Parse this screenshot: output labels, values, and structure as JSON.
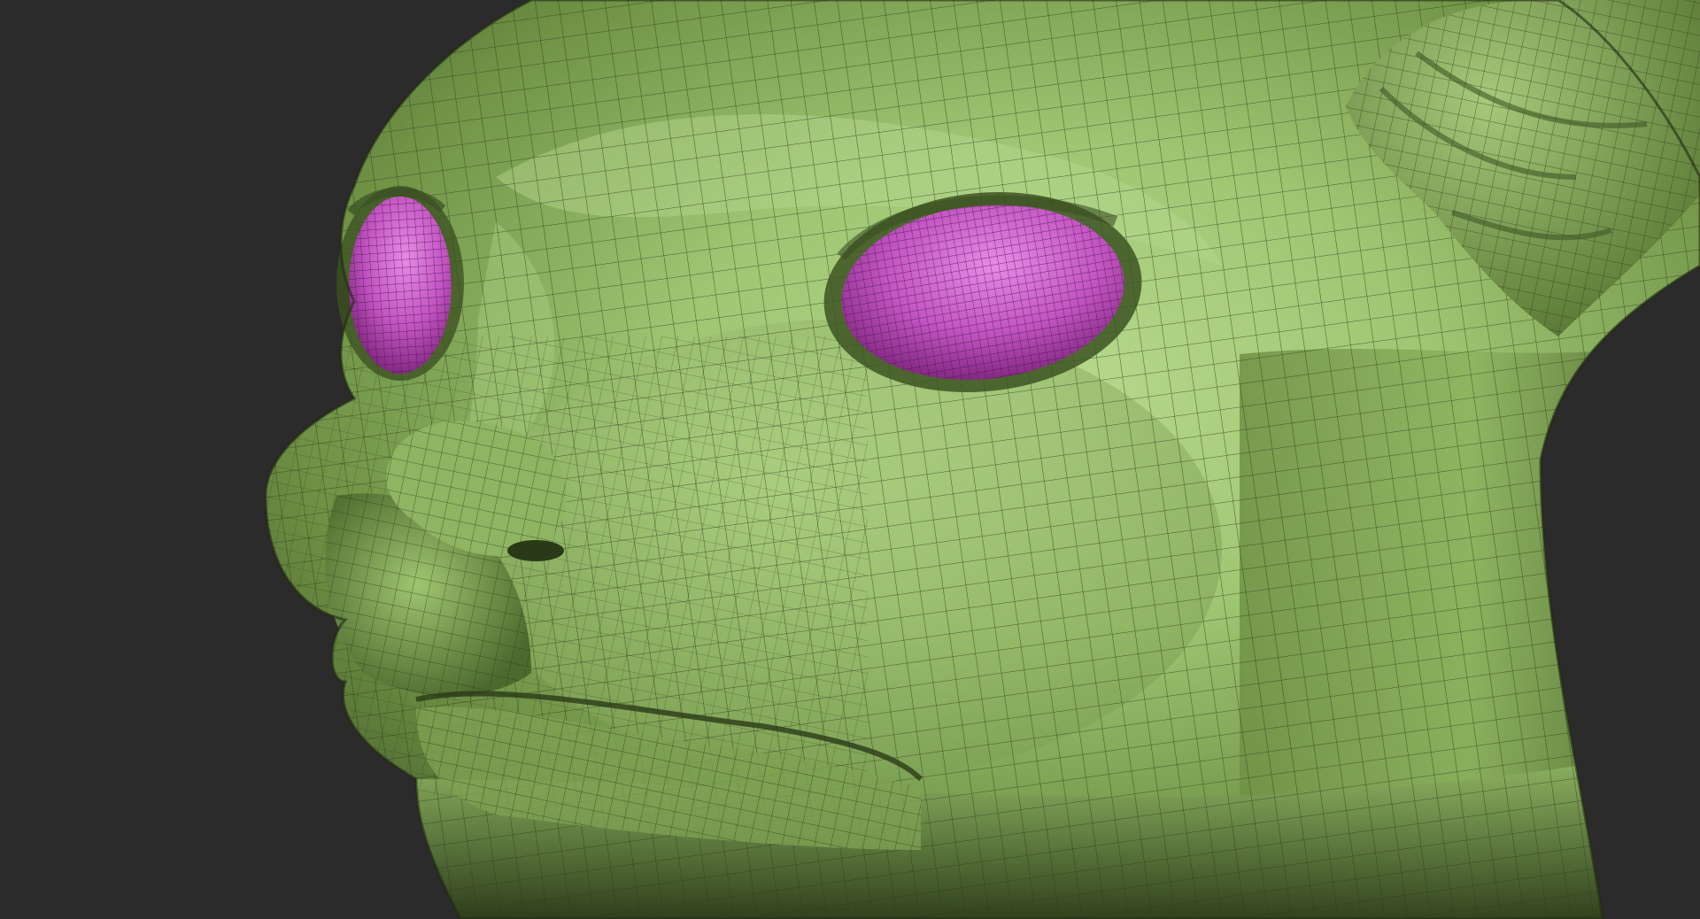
{
  "viewport": {
    "background_color": "#2b2b2b"
  },
  "model": {
    "subject": "creature-head-sculpt",
    "skin_color": "#8aaf5c",
    "skin_highlight": "#b6d98a",
    "skin_shadow": "#3f5524",
    "wire_color": "#2c3a1c",
    "eye_color": "#c455c4",
    "eye_highlight": "#e68ae6",
    "eye_shadow": "#6e1f6e",
    "display_mode": "polyframe"
  }
}
